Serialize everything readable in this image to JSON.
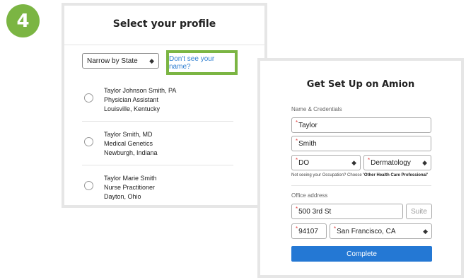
{
  "step_number": "4",
  "profile": {
    "title": "Select your profile",
    "state_filter": "Narrow by State",
    "missing_name_link": "Don't see your name?",
    "items": [
      {
        "name": "Taylor Johnson Smith, PA",
        "role": "Physician Assistant",
        "location": "Louisville, Kentucky"
      },
      {
        "name": "Taylor Smith, MD",
        "role": "Medical Genetics",
        "location": "Newburgh, Indiana"
      },
      {
        "name": "Taylor Marie Smith",
        "role": "Nurse Practitioner",
        "location": "Dayton, Ohio"
      }
    ]
  },
  "setup": {
    "title": "Get Set Up on Amion",
    "name_section": "Name & Credentials",
    "first_name": "Taylor",
    "last_name": "Smith",
    "occupation": "DO",
    "specialty": "Dermatology",
    "hint_prefix": "Not seeing your Occupation? Choose ",
    "hint_option": "'Other Health Care Professional'",
    "office_section": "Office address",
    "street": "500 3rd St",
    "suite_placeholder": "Suite",
    "zip": "94107",
    "city": "San Francisco, CA",
    "complete_label": "Complete"
  },
  "colors": {
    "accent_green": "#7bb543",
    "primary_blue": "#2478d4",
    "link_blue": "#2f7fd1",
    "required_red": "#e04040"
  },
  "icons": {
    "select_arrows": "up-down-caret-icon"
  }
}
